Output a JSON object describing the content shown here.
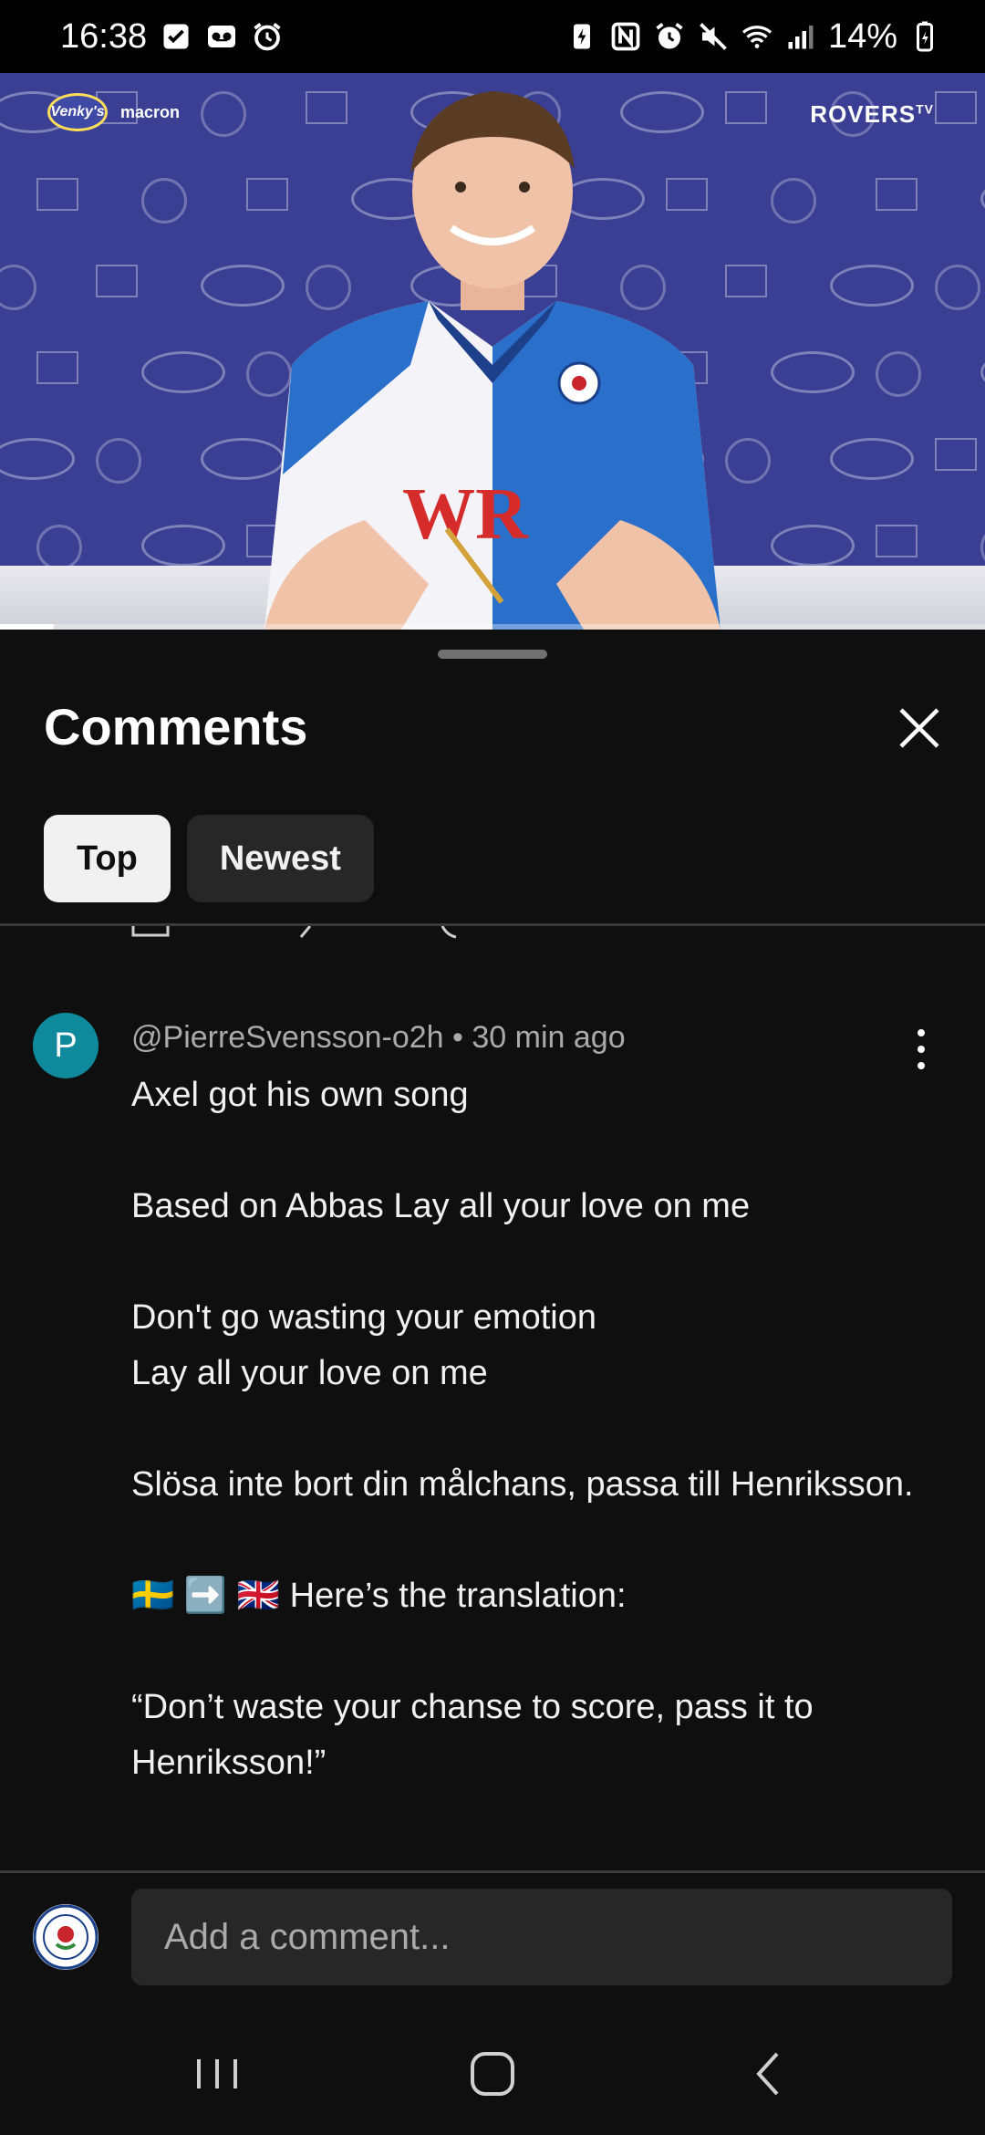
{
  "status_bar": {
    "time": "16:38",
    "battery": "14%",
    "left_icons": [
      "checkbox-icon",
      "voicemail-icon",
      "alarm-icon"
    ],
    "right_icons": [
      "battery-saver-icon",
      "nfc-icon",
      "alarm-icon",
      "mute-icon",
      "wifi-icon",
      "signal-icon",
      "battery-icon"
    ]
  },
  "video": {
    "overlay_logo": "ROVERS",
    "overlay_logo_sup": "TV",
    "sponsor_top_left": "Venky's",
    "sponsor_top_left_sub": "macron",
    "progress_fraction": 0.055
  },
  "comments_sheet": {
    "title": "Comments",
    "chips": [
      {
        "label": "Top",
        "active": true
      },
      {
        "label": "Newest",
        "active": false
      }
    ]
  },
  "comment": {
    "avatar_letter": "P",
    "author": "@PierreSvensson-o2h",
    "time": "30 min ago",
    "separator": "•",
    "lines": {
      "l1": "Axel got his own song",
      "l2": "Based on Abbas Lay all your love on me",
      "l3": "Don't go wasting your emotion",
      "l4": "Lay all your love on me",
      "l5": "Slösa inte bort din målchans, passa till Henriksson.",
      "l6": "Here’s the translation:",
      "l7": "“Don’t waste your chanse to score, pass it to Henriksson!”"
    },
    "translation_emoji": "🇸🇪 ➡️ 🇬🇧"
  },
  "composer": {
    "placeholder": "Add a comment..."
  },
  "colors": {
    "background": "#0f0f0f",
    "chip_active": "#f1f1f1",
    "chip_inactive": "#272727",
    "avatar": "#0e8a9c",
    "backdrop": "#3b3f93",
    "kit_blue": "#2a6fc9"
  }
}
